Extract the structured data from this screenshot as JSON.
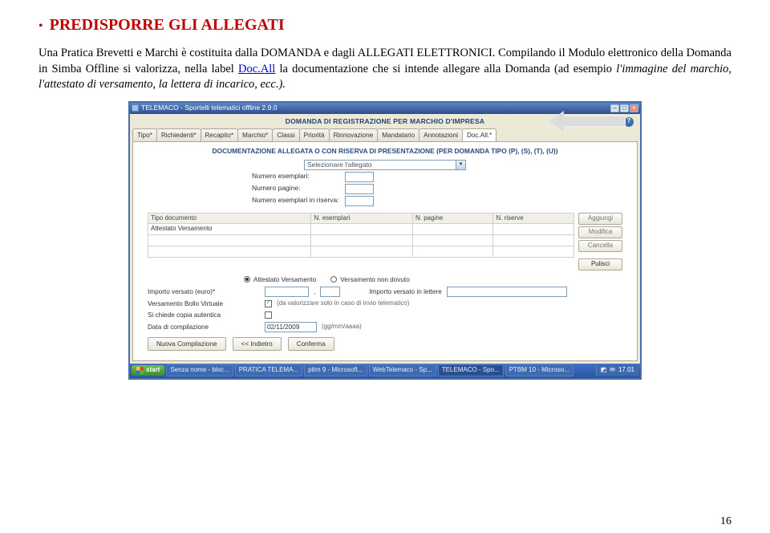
{
  "heading": "PREDISPORRE GLI ALLEGATI",
  "paragraph": {
    "p1": "Una Pratica Brevetti e Marchi è costituita dalla DOMANDA e dagli ALLEGATI ELETTRONICI. Compilando il Modulo elettronico della Domanda in Simba Offline si valorizza, nella label ",
    "link": "Doc.All",
    "p2": " la documentazione che si intende allegare alla Domanda (ad esempio ",
    "italic": "l'immagine del marchio, l'attestato di versamento, la lettera di incarico, ecc.).",
    "p2tail": ""
  },
  "window": {
    "title": "TELEMACO - Sportelli telematici offline 2.9.0",
    "help_icon": "?",
    "win_buttons": {
      "min": "–",
      "max": "□",
      "close": "×"
    },
    "main_title": "DOMANDA DI REGISTRAZIONE PER MARCHIO D'IMPRESA",
    "tabs": [
      "Tipo*",
      "Richiedenti*",
      "Recapito*",
      "Marchio*",
      "Classi",
      "Priorità",
      "Rinnovazione",
      "Mandatario",
      "Annotazioni",
      "Doc.All.*"
    ],
    "panel": {
      "section_title": "DOCUMENTAZIONE ALLEGATA O CON RISERVA DI PRESENTAZIONE (PER DOMANDA TIPO (P), (S), (T), (U))",
      "allegato_label": "",
      "allegato_placeholder": "Selezionare l'allegato",
      "rows": [
        {
          "label": "Numero esemplari:"
        },
        {
          "label": "Numero pagine:"
        },
        {
          "label": "Numero esemplari in riserva:"
        }
      ],
      "grid": {
        "headers": [
          "Tipo documento",
          "N. esemplari",
          "N. pagine",
          "N. riserve"
        ],
        "row1": "Attestato Versamento"
      },
      "buttons": {
        "add": "Aggiungi",
        "edit": "Modifica",
        "del": "Cancella",
        "clear": "Pulisci"
      }
    },
    "bottom": {
      "radio1": "Attestato Versamento",
      "radio2": "Versamento non dovuto",
      "importo_label": "Importo versato (euro)*",
      "comma": ",",
      "importo_lettere_label": "Importo versato in lettere",
      "bollo_label": "Versamento Bollo Virtuale",
      "bollo_checked": "✓",
      "bollo_hint": "(da valorizzare solo in caso di invio telematico)",
      "copia_label": "Si chiede copia autentica",
      "data_label": "Data di compilazione",
      "data_value": "02/11/2009",
      "data_hint": "(gg/mm/aaaa)"
    },
    "main_buttons": {
      "new": "Nuova Compilazione",
      "back": "<< Indietro",
      "confirm": "Conferma"
    }
  },
  "taskbar": {
    "start": "start",
    "items": [
      "Senza nome - bloc...",
      "PRATICA TELEMA...",
      "pttm 9 - Microsoft...",
      "WebTelemaco - Sp...",
      "TELEMACO - Spo...",
      "PTBM 10 - Microso..."
    ],
    "clock": "17.01"
  },
  "page_number": "16"
}
